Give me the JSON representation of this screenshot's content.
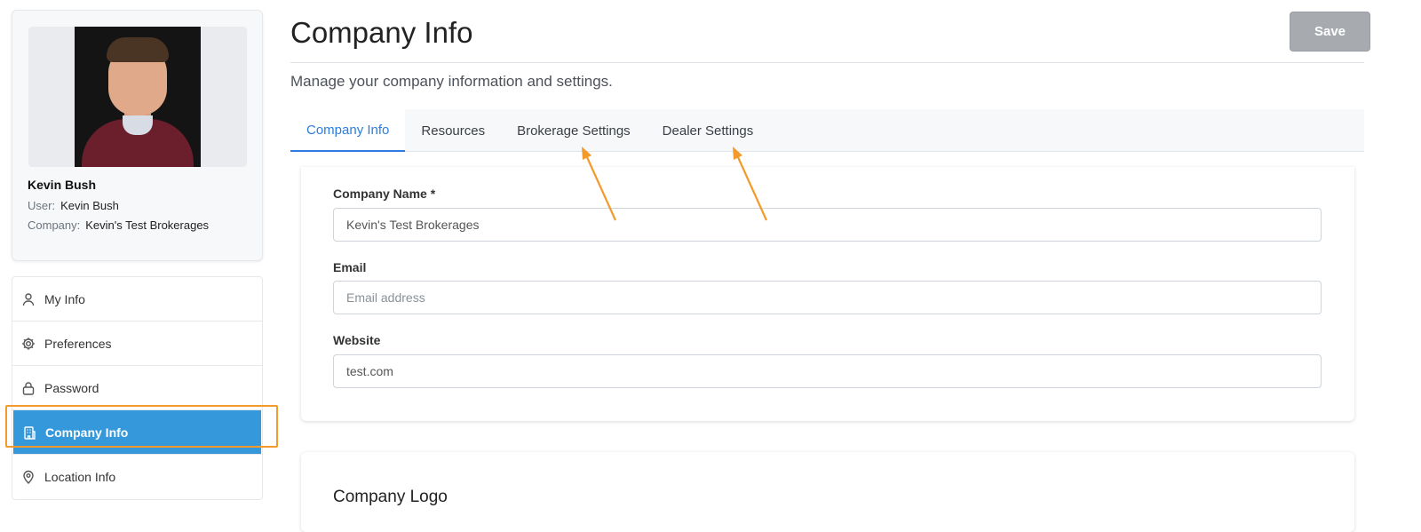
{
  "profile": {
    "name": "Kevin Bush",
    "user_label": "User:",
    "user_value": "Kevin Bush",
    "company_label": "Company:",
    "company_value": "Kevin's Test Brokerages"
  },
  "sidebar": {
    "items": [
      {
        "label": "My Info",
        "icon": "person-icon"
      },
      {
        "label": "Preferences",
        "icon": "gear-icon"
      },
      {
        "label": "Password",
        "icon": "lock-icon"
      },
      {
        "label": "Company Info",
        "icon": "building-icon",
        "active": true
      },
      {
        "label": "Location Info",
        "icon": "map-pin-icon"
      }
    ]
  },
  "header": {
    "title": "Company Info",
    "subtitle": "Manage your company information and settings.",
    "save_label": "Save"
  },
  "tabs": [
    {
      "label": "Company Info",
      "active": true
    },
    {
      "label": "Resources"
    },
    {
      "label": "Brokerage Settings"
    },
    {
      "label": "Dealer Settings"
    }
  ],
  "form": {
    "company_name_label": "Company Name *",
    "company_name_value": "Kevin's Test Brokerages",
    "email_label": "Email",
    "email_placeholder": "Email address",
    "email_value": "",
    "website_label": "Website",
    "website_value": "test.com"
  },
  "logo_section": {
    "title": "Company Logo"
  },
  "colors": {
    "accent": "#2b7de1",
    "active_menu": "#3498db",
    "annotation": "#f39a2c",
    "save_disabled": "#a7abb0"
  }
}
